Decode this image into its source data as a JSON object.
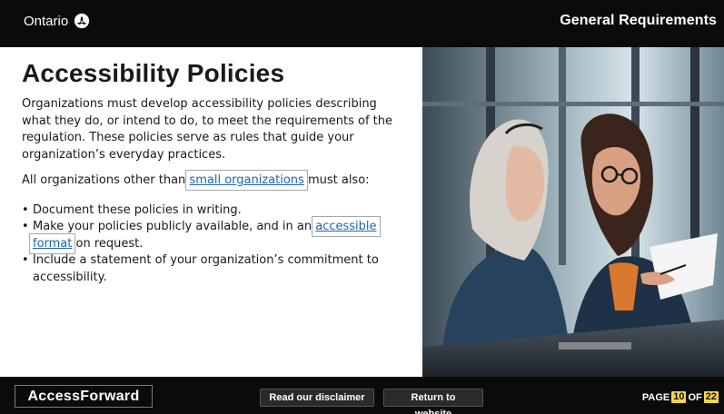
{
  "header": {
    "brand_label": "Ontario",
    "section_title": "General Requirements"
  },
  "main": {
    "title": "Accessibility Policies",
    "intro": "Organizations must develop accessibility policies describing what they do, or intend to do, to meet the requirements of the regulation. These policies serve as rules that guide your organization’s everyday practices.",
    "all_orgs_before": "All organizations other than ",
    "small_orgs_link": "small organizations",
    "all_orgs_after": " must also:",
    "bullet_1": "Document these policies in writing.",
    "bullet_2_before": "Make your policies publicly available, and in an ",
    "accessible_format_link": "accessible format",
    "bullet_2_after": " on request.",
    "bullet_3": "Include a statement of your organization’s commitment to accessibility."
  },
  "footer": {
    "logo": "AccessForward",
    "disclaimer_button": "Read our disclaimer",
    "website_button": "Return to website",
    "page_label": "PAGE",
    "current_page": "10",
    "of_label": "OF",
    "total_pages": "22"
  },
  "colors": {
    "bar_bg": "#0b0b0b",
    "link": "#1a65b6",
    "page_highlight": "#f7d54b"
  }
}
